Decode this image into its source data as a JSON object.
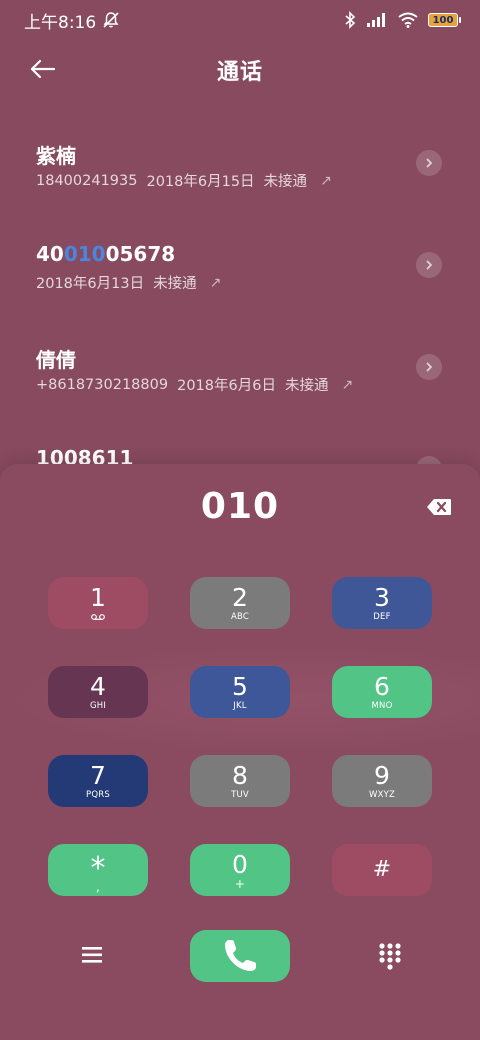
{
  "status_bar": {
    "time": "上午8:16",
    "battery": "100"
  },
  "header": {
    "title": "通话"
  },
  "calls": [
    {
      "name": "紫楠",
      "number": "18400241935",
      "date": "2018年6月15日",
      "status": "未接通"
    },
    {
      "name_prefix": "40",
      "name_highlight": "010",
      "name_suffix": "05678",
      "date": "2018年6月13日",
      "status": "未接通"
    },
    {
      "name": "倩倩",
      "number": "+8618730218809",
      "date": "2018年6月6日",
      "status": "未接通"
    },
    {
      "name": "1008611"
    }
  ],
  "dialpad": {
    "dialed": "010",
    "keys": [
      {
        "digit": "1",
        "letters": "",
        "color": "#9d4c63"
      },
      {
        "digit": "2",
        "letters": "ABC",
        "color": "#7b7b7b"
      },
      {
        "digit": "3",
        "letters": "DEF",
        "color": "#3f5797"
      },
      {
        "digit": "4",
        "letters": "GHI",
        "color": "#663552"
      },
      {
        "digit": "5",
        "letters": "JKL",
        "color": "#3e5799"
      },
      {
        "digit": "6",
        "letters": "MNO",
        "color": "#52c485"
      },
      {
        "digit": "7",
        "letters": "PQRS",
        "color": "#243a76"
      },
      {
        "digit": "8",
        "letters": "TUV",
        "color": "#7b7b7b"
      },
      {
        "digit": "9",
        "letters": "WXYZ",
        "color": "#7b7b7b"
      },
      {
        "digit": "*",
        "letters": ",",
        "color": "#52c485"
      },
      {
        "digit": "0",
        "letters": "+",
        "color": "#52c485"
      },
      {
        "digit": "#",
        "letters": "",
        "color": "#9d4c63"
      }
    ]
  },
  "colors": {
    "background": "#874a5f",
    "call_button": "#52c485",
    "highlight": "#4a86e0"
  }
}
